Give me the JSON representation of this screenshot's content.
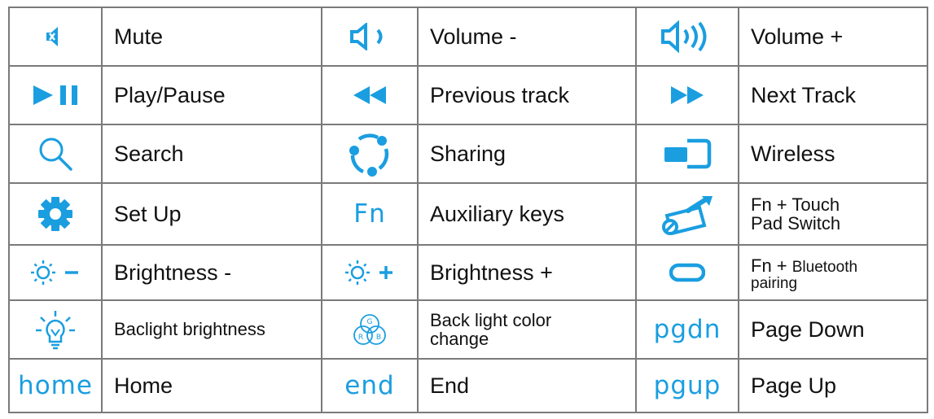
{
  "rows": [
    [
      {
        "icon": "mute-icon",
        "label": "Mute"
      },
      {
        "icon": "volume-down-icon",
        "label": "Volume -"
      },
      {
        "icon": "volume-up-icon",
        "label": "Volume +"
      }
    ],
    [
      {
        "icon": "play-pause-icon",
        "label": "Play/Pause"
      },
      {
        "icon": "previous-track-icon",
        "label": "Previous track"
      },
      {
        "icon": "next-track-icon",
        "label": "Next Track"
      }
    ],
    [
      {
        "icon": "search-icon",
        "label": "Search"
      },
      {
        "icon": "sharing-icon",
        "label": "Sharing"
      },
      {
        "icon": "wireless-icon",
        "label": "Wireless"
      }
    ],
    [
      {
        "icon": "gear-icon",
        "label": "Set Up"
      },
      {
        "icon_text": "Fn",
        "label": "Auxiliary keys"
      },
      {
        "icon": "touchpad-switch-icon",
        "label_line1": "Fn + Touch",
        "label_line2": "Pad Switch"
      }
    ],
    [
      {
        "icon": "brightness-down-icon",
        "label": "Brightness -"
      },
      {
        "icon": "brightness-up-icon",
        "label": "Brightness +"
      },
      {
        "icon": "bluetooth-pairing-icon",
        "label_line1": "Fn + Bluetooth",
        "label_line2": "pairing"
      }
    ],
    [
      {
        "icon": "backlight-bulb-icon",
        "label": "Baclight brightness"
      },
      {
        "icon": "rgb-color-icon",
        "icon_letters": [
          "G",
          "R",
          "B"
        ],
        "label_line1": "Back light color",
        "label_line2": "change"
      },
      {
        "icon_text": "pgdn",
        "label": "Page Down"
      }
    ],
    [
      {
        "icon_text": "home",
        "label": "Home"
      },
      {
        "icon_text": "end",
        "label": "End"
      },
      {
        "icon_text": "pgup",
        "label": "Page Up"
      }
    ]
  ],
  "colors": {
    "accent": "#1a9ee0",
    "border": "#7a7a7a",
    "text": "#111111"
  }
}
